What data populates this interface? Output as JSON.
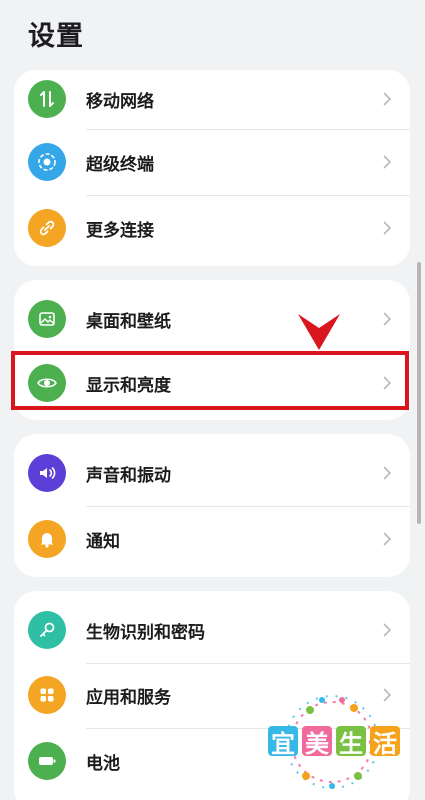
{
  "header": {
    "title": "设置"
  },
  "groups": [
    {
      "items": [
        {
          "label": "移动网络",
          "icon": "mobile-data-icon",
          "color": "#4caf50"
        },
        {
          "label": "超级终端",
          "icon": "super-device-icon",
          "color": "#35a6e8"
        },
        {
          "label": "更多连接",
          "icon": "link-icon",
          "color": "#f4a523"
        }
      ]
    },
    {
      "items": [
        {
          "label": "桌面和壁纸",
          "icon": "wallpaper-icon",
          "color": "#4caf50"
        },
        {
          "label": "显示和亮度",
          "icon": "eye-icon",
          "color": "#4caf50"
        }
      ]
    },
    {
      "items": [
        {
          "label": "声音和振动",
          "icon": "speaker-icon",
          "color": "#5b3fd6"
        },
        {
          "label": "通知",
          "icon": "bell-icon",
          "color": "#f4a523"
        }
      ]
    },
    {
      "items": [
        {
          "label": "生物识别和密码",
          "icon": "key-icon",
          "color": "#2fbfa5"
        },
        {
          "label": "应用和服务",
          "icon": "apps-grid-icon",
          "color": "#f4a523"
        },
        {
          "label": "电池",
          "icon": "battery-icon",
          "color": "#4caf50"
        }
      ]
    }
  ],
  "watermark": {
    "chars": [
      "宜",
      "美",
      "生",
      "活"
    ],
    "colors": [
      "#37b8e6",
      "#f06a9c",
      "#7ac143",
      "#f7a21b"
    ]
  },
  "highlight_color": "#d9161d"
}
